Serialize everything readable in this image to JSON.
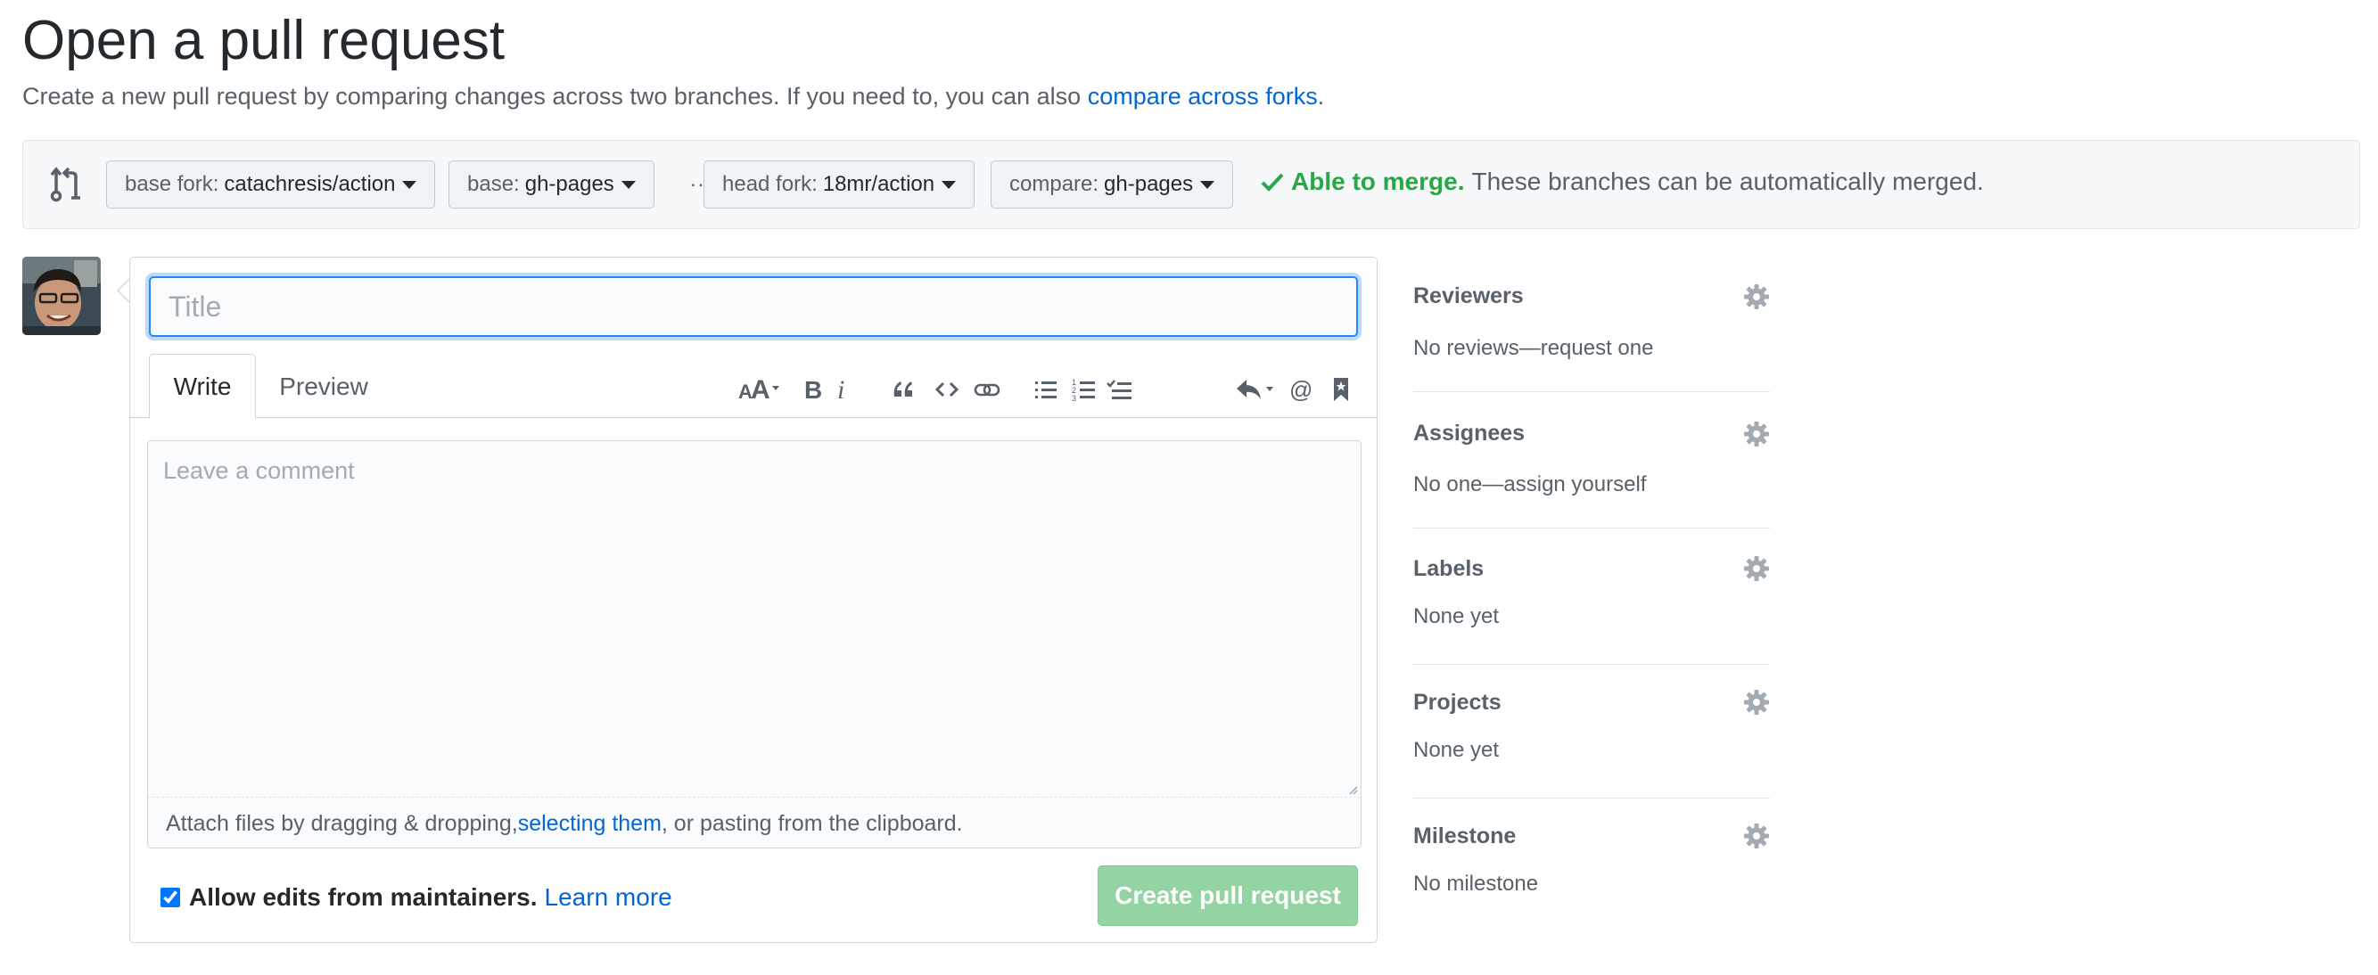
{
  "header": {
    "title": "Open a pull request",
    "subtitle_text": "Create a new pull request by comparing changes across two branches. If you need to, you can also ",
    "subtitle_link": "compare across forks",
    "subtitle_end": "."
  },
  "range": {
    "base_fork_label": "base fork:",
    "base_fork_value": "catachresis/action",
    "base_label": "base:",
    "base_value": "gh-pages",
    "ellipsis": "...",
    "head_fork_label": "head fork:",
    "head_fork_value": "18mr/action",
    "compare_label": "compare:",
    "compare_value": "gh-pages",
    "merge_ok": "Able to merge.",
    "merge_detail": "These branches can be automatically merged."
  },
  "form": {
    "title_placeholder": "Title",
    "tab_write": "Write",
    "tab_preview": "Preview",
    "comment_placeholder": "Leave a comment",
    "attach_text_1": "Attach files by dragging & dropping, ",
    "attach_link": "selecting them",
    "attach_text_2": ", or pasting from the clipboard.",
    "allow_edits_label": "Allow edits from maintainers.",
    "allow_edits_checked": true,
    "learn_more": "Learn more",
    "create_button": "Create pull request"
  },
  "sidebar": {
    "reviewers_heading": "Reviewers",
    "reviewers_value": "No reviews—request one",
    "assignees_heading": "Assignees",
    "assignees_value": "No one—assign yourself",
    "labels_heading": "Labels",
    "labels_value": "None yet",
    "projects_heading": "Projects",
    "projects_value": "None yet",
    "milestone_heading": "Milestone",
    "milestone_value": "No milestone"
  },
  "colors": {
    "accent_link": "#0366d6",
    "merge_green": "#28a745",
    "create_button_disabled": "#94d3a2",
    "focus_border": "#2188ff"
  },
  "icons": {
    "range": "git-compare-icon",
    "toolbar": [
      "text-size-icon",
      "bold-icon",
      "italic-icon",
      "quote-icon",
      "code-icon",
      "link-icon",
      "bulleted-list-icon",
      "numbered-list-icon",
      "task-list-icon",
      "reply-icon",
      "mention-icon",
      "bookmark-icon"
    ],
    "sidebar_gear": "gear-icon",
    "merge_check": "check-icon"
  }
}
